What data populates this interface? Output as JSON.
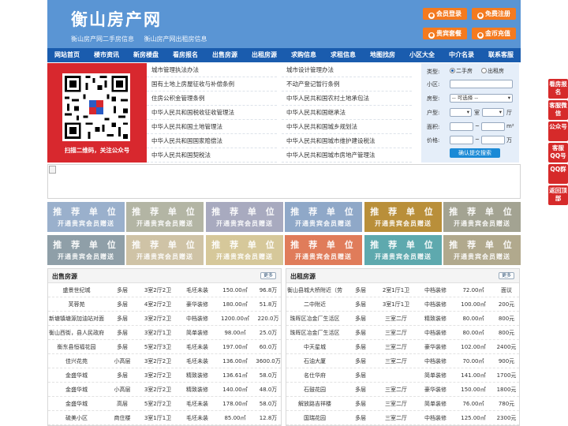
{
  "header": {
    "title": "衡山房产网",
    "subtitle_links": [
      "衡山房产网二手房信息",
      "衡山房产网出租房信息"
    ],
    "buttons": [
      "会员登录",
      "免费注册",
      "贵宾套餐",
      "金币充值"
    ]
  },
  "nav": [
    "网站首页",
    "楼市资讯",
    "新房楼盘",
    "看房报名",
    "出售房源",
    "出租房源",
    "求购信息",
    "求租信息",
    "地图找房",
    "小区大全",
    "中介名录",
    "联系客服"
  ],
  "qr": {
    "caption": "扫描二维码，关注公众号"
  },
  "laws": {
    "left": [
      "城市管理执法办法",
      "国有土地上房屋征收与补偿条例",
      "住房公积金管理条例",
      "中华人民共和国税收征收管理法",
      "中华人民共和国土地管理法",
      "中华人民共和国国家赔偿法",
      "中华人民共和国契税法"
    ],
    "right": [
      "城市设计管理办法",
      "不动产登记暂行条例",
      "中华人民共和国农村土地承包法",
      "中华人民共和国继承法",
      "中华人民共和国城乡规划法",
      "中华人民共和国城市维护建设税法",
      "中华人民共和国城市房地产管理法"
    ]
  },
  "search": {
    "type_label": "类型:",
    "type_options": [
      "二手房",
      "出租房"
    ],
    "type_selected": "二手房",
    "community_label": "小区:",
    "community_value": "",
    "house_type_label": "房型:",
    "house_type_value": "-- 可选择 --",
    "layout_label": "户型:",
    "room_unit": "室",
    "hall_unit": "厅",
    "area_label": "面积:",
    "area_unit": "m²",
    "price_label": "价格:",
    "price_unit": "万",
    "range_sep": "~",
    "submit": "确认提交搜索"
  },
  "ads": {
    "title": "推 荐 单 位",
    "subtitle": "开通贵宾会员赠送",
    "colors": [
      "#9ab0cc",
      "#b3b5a4",
      "#a8aabf",
      "#8fa8c8",
      "#b98f3a",
      "#a3a392",
      "#8f9fa8",
      "#cfc3a6",
      "#d6c89a",
      "#e07c5a",
      "#5ea9ae",
      "#b1a98d"
    ]
  },
  "sale": {
    "title": "出售房源",
    "more": "更多",
    "rows": [
      [
        "盛景世纪城",
        "多层",
        "3室2厅2卫",
        "毛坯未装",
        "150.00㎡",
        "96.8万"
      ],
      [
        "芙蓉苑",
        "多层",
        "4室2厅2卫",
        "豪华装修",
        "180.00㎡",
        "51.8万"
      ],
      [
        "新塘镇塘源加油站对面",
        "多层",
        "3室2厅2卫",
        "中档装修",
        "1200.00㎡",
        "220.0万"
      ],
      [
        "衡山西街，县人民政府",
        "多层",
        "3室2厅1卫",
        "简单装修",
        "98.00㎡",
        "25.0万"
      ],
      [
        "衡东县恒福花园",
        "多层",
        "5室2厅3卫",
        "毛坯未装",
        "197.00㎡",
        "60.0万"
      ],
      [
        "佳兴花苑",
        "小高层",
        "3室2厅2卫",
        "毛坯未装",
        "136.00㎡",
        "3600.0万"
      ],
      [
        "金盛华城",
        "多层",
        "3室2厅2卫",
        "精致装修",
        "136.61㎡",
        "58.0万"
      ],
      [
        "金盛华城",
        "小高层",
        "3室2厅2卫",
        "精致装修",
        "140.00㎡",
        "48.0万"
      ],
      [
        "金盛华城",
        "高层",
        "5室2厅2卫",
        "毛坯未装",
        "178.00㎡",
        "58.0万"
      ],
      [
        "硫美小区",
        "商住楼",
        "3室1厅1卫",
        "毛坯未装",
        "85.00㎡",
        "12.8万"
      ]
    ]
  },
  "rent": {
    "title": "出租房源",
    "more": "更多",
    "rows": [
      [
        "衡山县城大桥附近（劳",
        "多层",
        "2室1厅1卫",
        "中档装修",
        "72.00㎡",
        "面议"
      ],
      [
        "二中附近",
        "多层",
        "3室1厅1卫",
        "中档装修",
        "100.00㎡",
        "200元"
      ],
      [
        "珠晖区冶金厂生活区",
        "多层",
        "三室二厅",
        "精致装修",
        "80.00㎡",
        "800元"
      ],
      [
        "珠晖区冶金厂生活区",
        "多层",
        "三室二厅",
        "中档装修",
        "80.00㎡",
        "800元"
      ],
      [
        "中天星城",
        "多层",
        "三室二厅",
        "豪华装修",
        "102.00㎡",
        "2400元"
      ],
      [
        "石油大厦",
        "多层",
        "三室二厅",
        "中档装修",
        "70.00㎡",
        "900元"
      ],
      [
        "名仕华府",
        "多层",
        "",
        "简单装修",
        "141.00㎡",
        "1700元"
      ],
      [
        "石鼓花园",
        "多层",
        "三室二厅",
        "豪华装修",
        "150.00㎡",
        "1800元"
      ],
      [
        "解放路吉祥楼",
        "多层",
        "三室二厅",
        "简单装修",
        "76.00㎡",
        "780元"
      ],
      [
        "国瑞花园",
        "多层",
        "三室二厅",
        "中档装修",
        "125.00㎡",
        "2300元"
      ]
    ]
  },
  "floating": [
    "看房报名",
    "客服微信",
    "公众号",
    "客服QQ号",
    "QQ群",
    "返回顶部"
  ]
}
